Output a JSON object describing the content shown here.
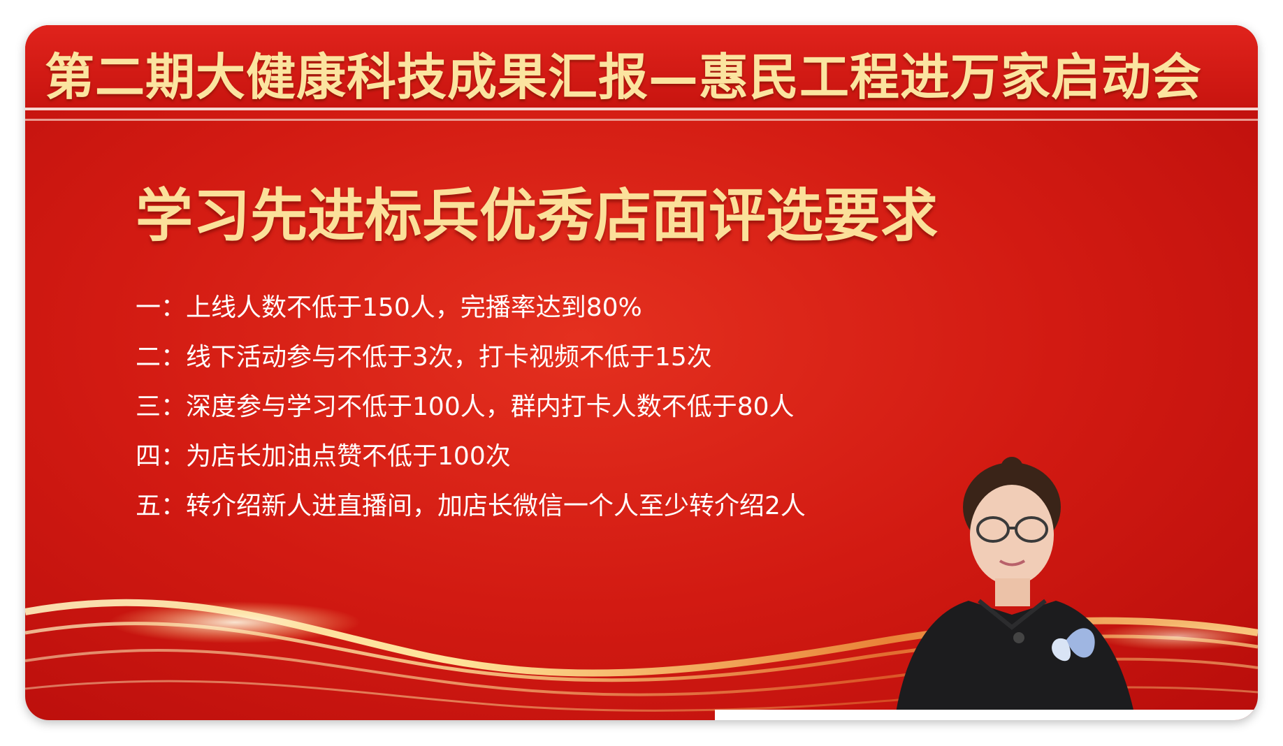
{
  "banner": {
    "title": "第二期大健康科技成果汇报—惠民工程进万家启动会"
  },
  "section": {
    "title": "学习先进标兵优秀店面评选要求"
  },
  "requirements": [
    {
      "marker": "一：",
      "text": "上线人数不低于150人，完播率达到80%"
    },
    {
      "marker": "二：",
      "text": "线下活动参与不低于3次，打卡视频不低于15次"
    },
    {
      "marker": "三：",
      "text": "深度参与学习不低于100人，群内打卡人数不低于80人"
    },
    {
      "marker": "四：",
      "text": "为店长加油点赞不低于100次"
    },
    {
      "marker": "五：",
      "text": "转介绍新人进直播间，加店长微信一个人至少转介绍2人"
    }
  ],
  "colors": {
    "background_red": "#d21a12",
    "title_gold": "#fbe09a",
    "text_white": "#ffffff"
  }
}
